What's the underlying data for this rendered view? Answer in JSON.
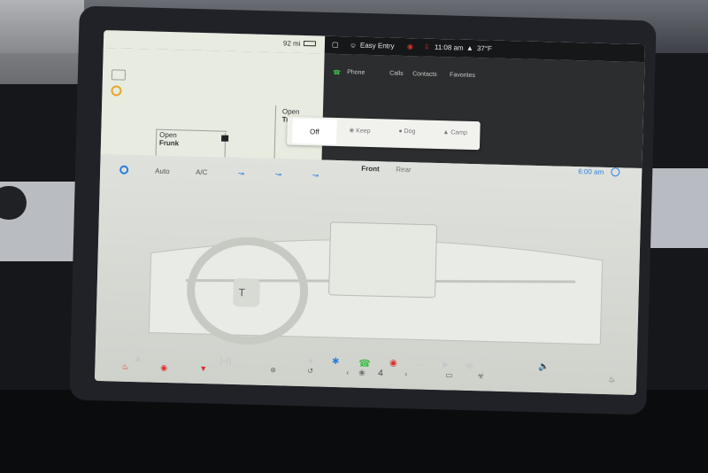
{
  "status": {
    "range": "92 mi",
    "profile": "Easy Entry",
    "time": "11:08 am",
    "temperature": "37°F"
  },
  "car": {
    "frunk_action": "Open",
    "frunk_label": "Frunk",
    "trunk_action": "Open",
    "trunk_label": "Trunk"
  },
  "phone": {
    "title": "Phone",
    "tabs": [
      "Calls",
      "Contacts",
      "Favorites"
    ]
  },
  "climate_mode": {
    "options": [
      "Off",
      "Keep",
      "Dog",
      "Camp"
    ],
    "selected": "Off"
  },
  "climate": {
    "auto_label": "Auto",
    "ac_label": "A/C",
    "front_label": "Front",
    "rear_label": "Rear",
    "schedule_time": "6:00 am",
    "fan_speed": "4"
  },
  "dock": {
    "driver_temp": "HI"
  },
  "colors": {
    "accent": "#2a7ee0",
    "warning": "#e9a528",
    "heat": "#d8322e",
    "phone": "#3fbf4b"
  }
}
